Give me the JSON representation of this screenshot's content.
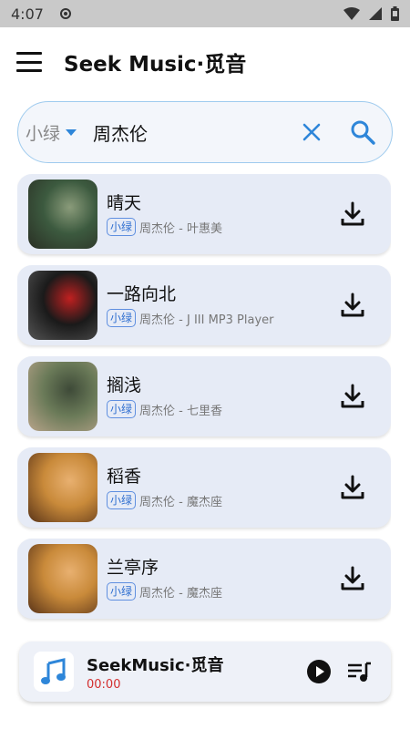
{
  "status_bar": {
    "time": "4:07"
  },
  "app_bar": {
    "title": "Seek Music·觅音"
  },
  "search": {
    "source": "小绿",
    "query": "周杰伦"
  },
  "songs": [
    {
      "title": "晴天",
      "tag": "小绿",
      "subtitle": "周杰伦 - 叶惠美",
      "cover_colors": [
        "#3c5a3f",
        "#2a2f24",
        "#8a9b7a"
      ]
    },
    {
      "title": "一路向北",
      "tag": "小绿",
      "subtitle": "周杰伦 - J III MP3 Player",
      "cover_colors": [
        "#1a1a1a",
        "#555555",
        "#c02020"
      ]
    },
    {
      "title": "搁浅",
      "tag": "小绿",
      "subtitle": "周杰伦 - 七里香",
      "cover_colors": [
        "#6a7a58",
        "#b8a48a",
        "#3e4a38"
      ]
    },
    {
      "title": "稻香",
      "tag": "小绿",
      "subtitle": "周杰伦 - 魔杰座",
      "cover_colors": [
        "#c98a3a",
        "#5a3418",
        "#e8b070"
      ]
    },
    {
      "title": "兰亭序",
      "tag": "小绿",
      "subtitle": "周杰伦 - 魔杰座",
      "cover_colors": [
        "#c98a3a",
        "#5a3418",
        "#e8b070"
      ]
    }
  ],
  "player": {
    "title": "SeekMusic·觅音",
    "time": "00:00"
  },
  "icons": {
    "menu": "menu-icon",
    "clear": "close-icon",
    "search": "search-icon",
    "download": "download-icon",
    "play": "play-icon",
    "queue": "playlist-icon",
    "music": "music-note-icon"
  },
  "colors": {
    "accent": "#2e86d9",
    "card": "#e6ebf6",
    "tag": "#2f6fd0",
    "time": "#d32f2f"
  }
}
